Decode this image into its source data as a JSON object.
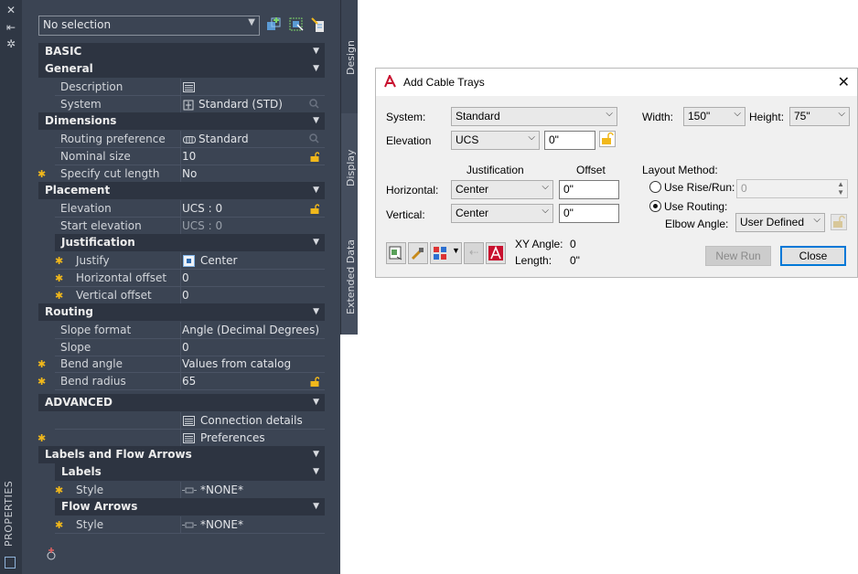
{
  "palette": {
    "vertical_title": "PROPERTIES",
    "selector": "No selection",
    "tabs": [
      "Design",
      "Display",
      "Extended Data"
    ],
    "sections": {
      "basic": "BASIC",
      "general": "General",
      "dimensions": "Dimensions",
      "placement": "Placement",
      "justification": "Justification",
      "routing": "Routing",
      "advanced": "ADVANCED",
      "labels_flow": "Labels and Flow Arrows",
      "labels": "Labels",
      "flow_arrows": "Flow Arrows"
    },
    "props": {
      "description": {
        "name": "Description",
        "value": ""
      },
      "system": {
        "name": "System",
        "value": "Standard (STD)"
      },
      "routing_pref": {
        "name": "Routing preference",
        "value": "Standard"
      },
      "nominal_size": {
        "name": "Nominal size",
        "value": "10"
      },
      "cut_length": {
        "name": "Specify cut length",
        "value": "No"
      },
      "elevation": {
        "name": "Elevation",
        "value": "UCS : 0"
      },
      "start_elevation": {
        "name": "Start elevation",
        "value": "UCS : 0"
      },
      "justify": {
        "name": "Justify",
        "value": "Center"
      },
      "h_offset": {
        "name": "Horizontal offset",
        "value": "0"
      },
      "v_offset": {
        "name": "Vertical offset",
        "value": "0"
      },
      "slope_format": {
        "name": "Slope format",
        "value": "Angle (Decimal Degrees)"
      },
      "slope": {
        "name": "Slope",
        "value": "0"
      },
      "bend_angle": {
        "name": "Bend angle",
        "value": "Values from catalog"
      },
      "bend_radius": {
        "name": "Bend radius",
        "value": "65"
      },
      "connection_details": {
        "value": "Connection details"
      },
      "preferences": {
        "value": "Preferences"
      },
      "label_style": {
        "name": "Style",
        "value": "*NONE*"
      },
      "flow_style": {
        "name": "Style",
        "value": "*NONE*"
      }
    }
  },
  "dialog": {
    "title": "Add Cable Trays",
    "system_label": "System:",
    "system_value": "Standard",
    "elevation_label": "Elevation",
    "elevation_mode": "UCS",
    "elevation_value": "0\"",
    "width_label": "Width:",
    "width_value": "150\"",
    "height_label": "Height:",
    "height_value": "75\"",
    "justification_header": "Justification",
    "offset_header": "Offset",
    "horizontal_label": "Horizontal:",
    "horizontal_value": "Center",
    "horizontal_offset": "0\"",
    "vertical_label": "Vertical:",
    "vertical_value": "Center",
    "vertical_offset": "0\"",
    "layout_method_label": "Layout Method:",
    "use_rise_run": "Use Rise/Run:",
    "rise_run_value": "0",
    "use_routing": "Use Routing:",
    "elbow_angle_label": "Elbow Angle:",
    "elbow_angle_value": "User Defined",
    "xy_angle_label": "XY Angle:",
    "xy_angle_value": "0",
    "length_label": "Length:",
    "length_value": "0\"",
    "new_run": "New Run",
    "close": "Close"
  }
}
